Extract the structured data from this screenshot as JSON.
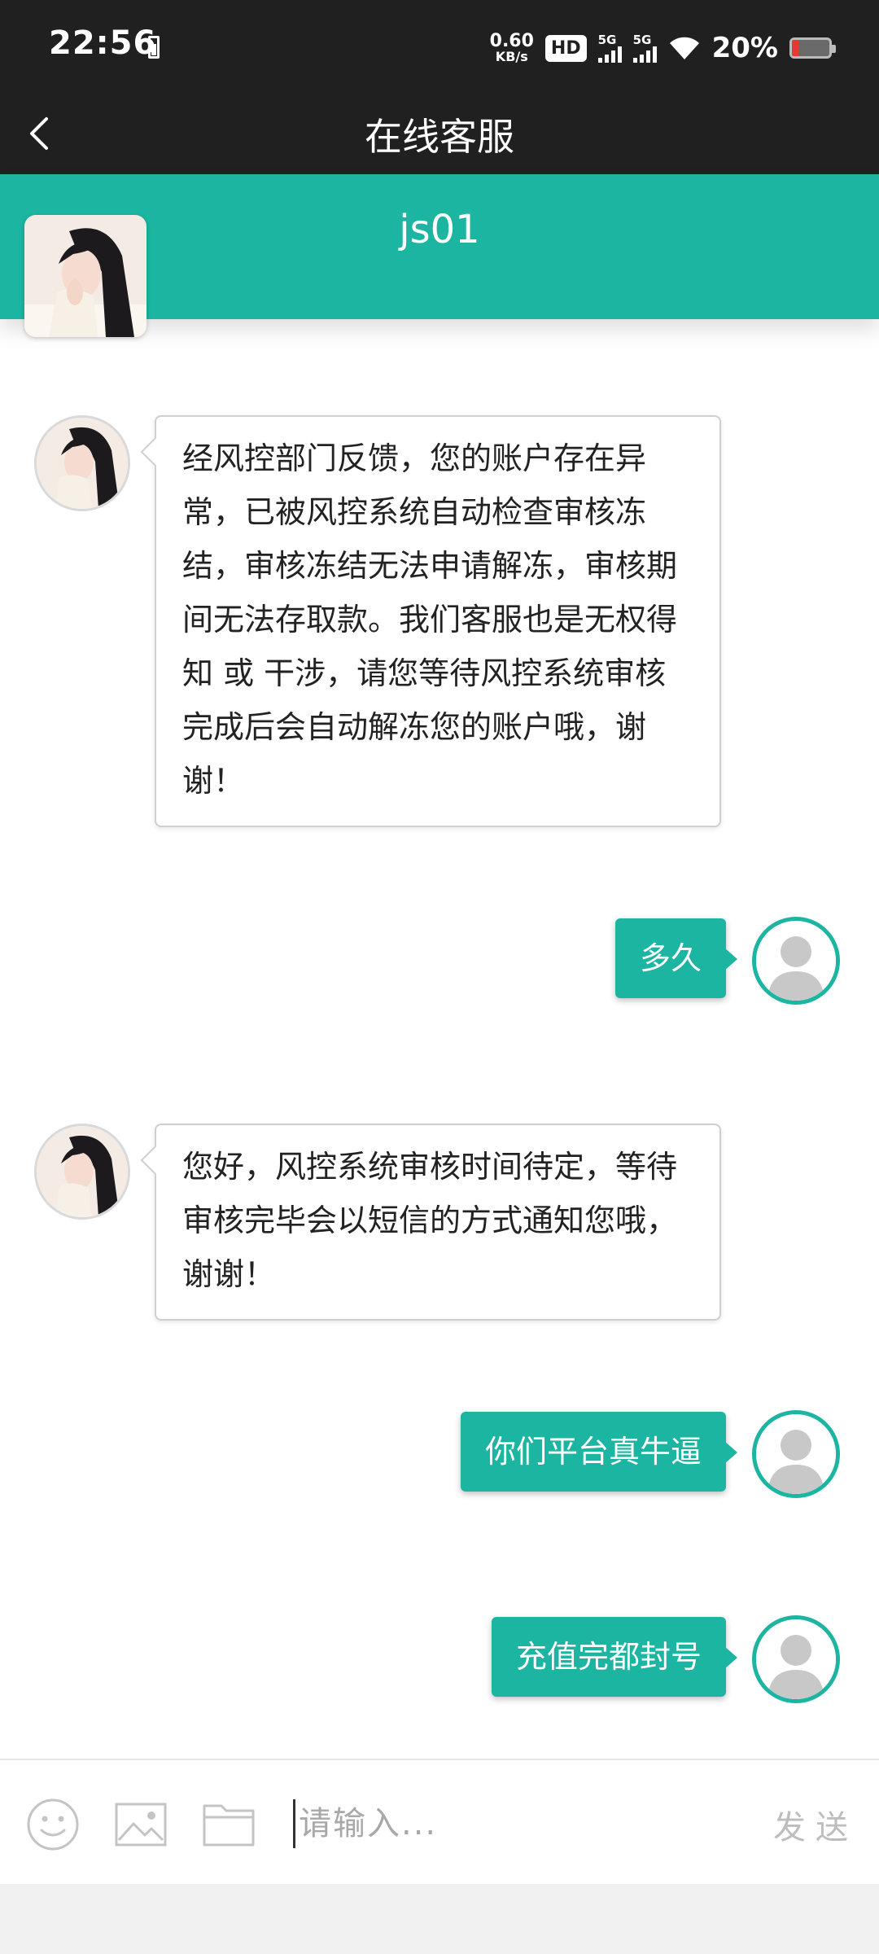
{
  "status_bar": {
    "time": "22:56",
    "net_speed_value": "0.60",
    "net_speed_unit": "KB/s",
    "hd_label": "HD",
    "signal1_label": "5G",
    "signal2_label": "5G",
    "battery_percent_text": "20%",
    "battery_level": 0.2,
    "battery_color": "#e53935"
  },
  "nav": {
    "back_icon": "chevron-left-icon",
    "title": "在线客服"
  },
  "agent": {
    "name": "js01"
  },
  "messages": [
    {
      "from": "service",
      "text": "经风控部门反馈，您的账户存在异常，已被风控系统自动检查审核冻结，审核冻结无法申请解冻，审核期间无法存取款。我们客服也是无权得知 或 干涉，请您等待风控系统审核完成后会自动解冻您的账户哦，谢谢！"
    },
    {
      "from": "user",
      "text": "多久"
    },
    {
      "from": "service",
      "text": "您好，风控系统审核时间待定，等待审核完毕会以短信的方式通知您哦，谢谢！"
    },
    {
      "from": "user",
      "text": "你们平台真牛逼"
    },
    {
      "from": "user",
      "text": "充值完都封号"
    }
  ],
  "input_bar": {
    "emoji_icon": "emoji-icon",
    "image_icon": "image-icon",
    "folder_icon": "folder-icon",
    "placeholder": "请输入...",
    "send_label": "发送"
  },
  "colors": {
    "accent": "#1cb5a1",
    "bar_dark": "#202020"
  }
}
